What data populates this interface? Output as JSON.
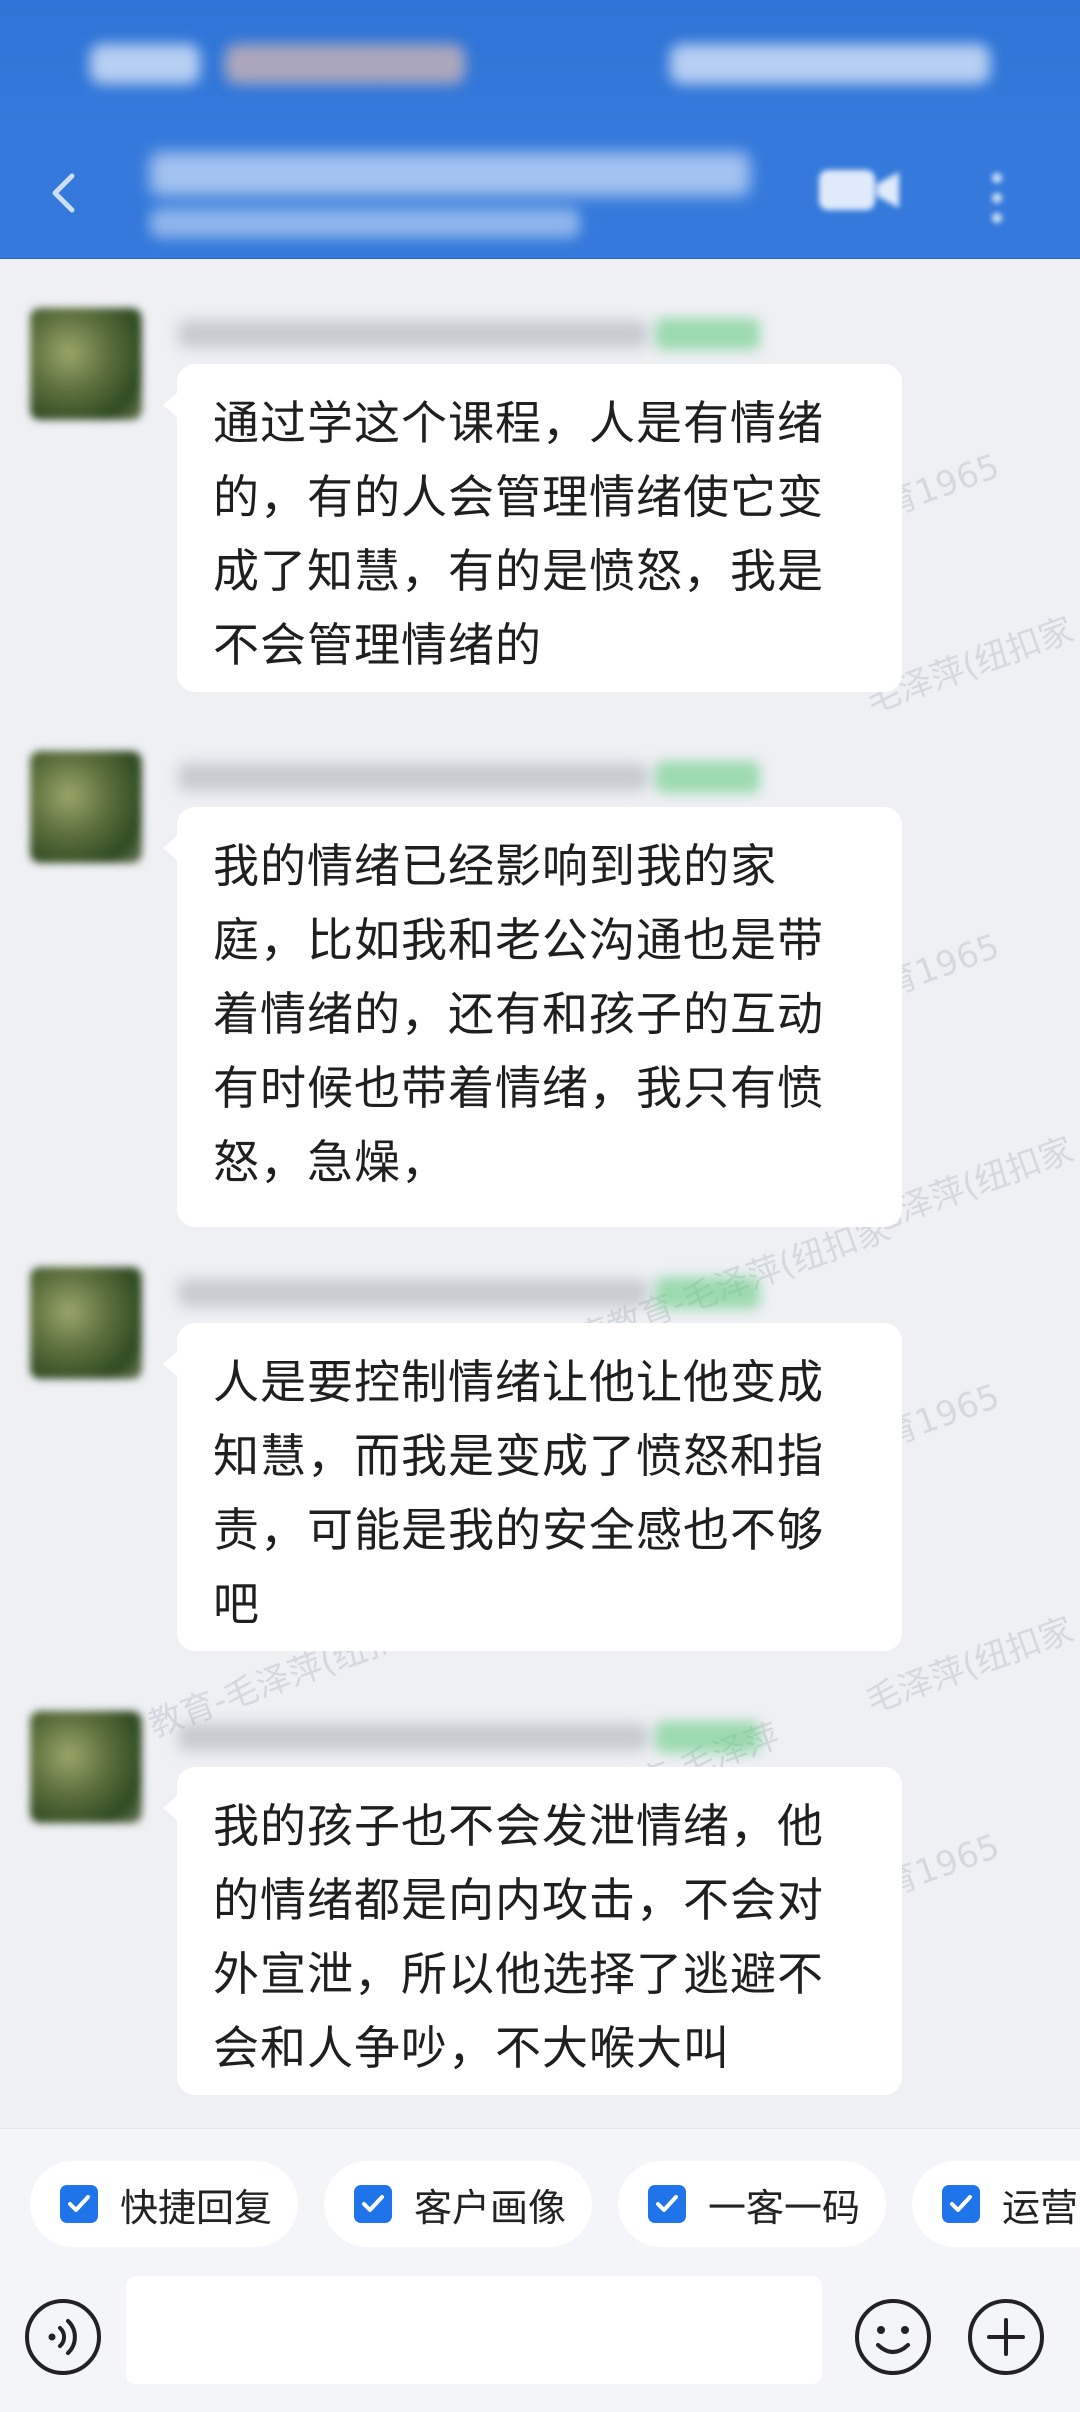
{
  "messages": [
    {
      "text": "通过学这个课程，人是有情绪的，有的人会管理情绪使它变成了知慧，有的是愤怒，我是不会管理情绪的"
    },
    {
      "text": "我的情绪已经影响到我的家庭，比如我和老公沟通也是带着情绪的，还有和孩子的互动有时候也带着情绪，我只有愤怒，急燥，"
    },
    {
      "text": "人是要控制情绪让他让他变成知慧，而我是变成了愤怒和指责，可能是我的安全感也不够吧"
    },
    {
      "text": "我的孩子也不会发泄情绪，他的情绪都是向内攻击，不会对外宣泄，所以他选择了逃避不会和人争吵，不大喉大叫"
    }
  ],
  "watermarks": [
    "育1965",
    "毛泽萍(纽扣家",
    "教育-毛泽萍(纽扣家",
    "扣家庭教育-毛泽萍(纽扣家",
    "教育-毛泽萍",
    "毛泽萍(纽扣"
  ],
  "quick_actions": [
    {
      "label": "快捷回复",
      "icon": "checkbox-icon"
    },
    {
      "label": "客户画像",
      "icon": "checkbox-icon"
    },
    {
      "label": "一客一码",
      "icon": "checkbox-icon"
    },
    {
      "label": "运营",
      "icon": "checkbox-icon"
    }
  ],
  "input": {
    "placeholder": ""
  },
  "colors": {
    "header": "#3479db",
    "bubble": "#ffffff",
    "background": "#eef0f4",
    "accent": "#1e74e8"
  }
}
